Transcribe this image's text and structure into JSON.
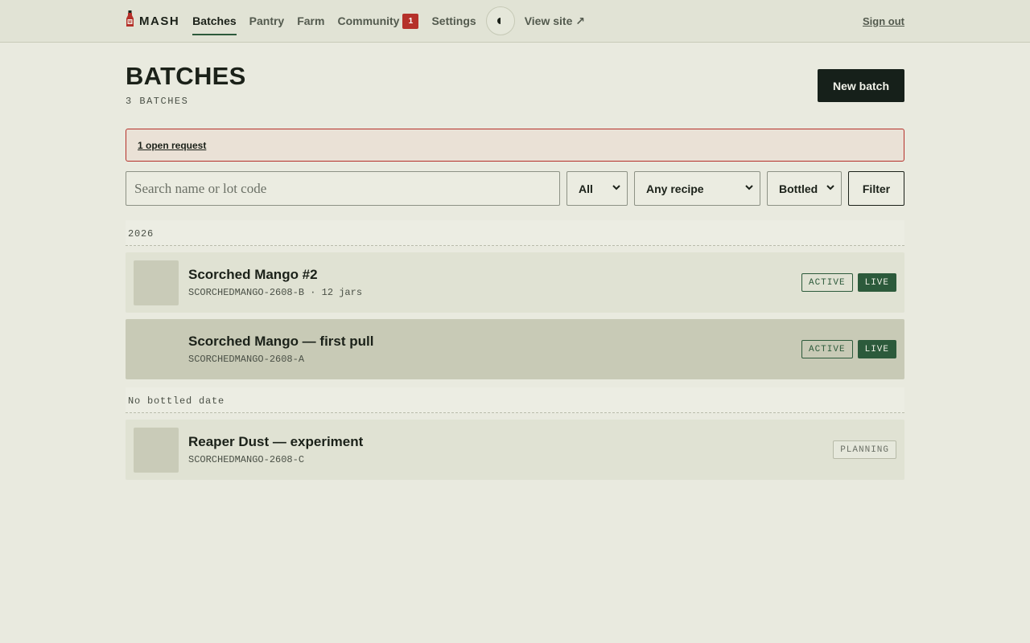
{
  "nav": {
    "brand": "MASH",
    "links": [
      {
        "label": "Batches"
      },
      {
        "label": "Pantry"
      },
      {
        "label": "Farm"
      },
      {
        "label": "Community",
        "badge": "1"
      },
      {
        "label": "Settings"
      }
    ],
    "view_site": "View site ↗",
    "sign_out": "Sign out"
  },
  "page": {
    "title": "BATCHES",
    "count": "3 BATCHES",
    "new_batch": "New batch"
  },
  "alert": {
    "text": "1 open request"
  },
  "filters": {
    "search_placeholder": "Search name or lot code",
    "status": "All",
    "recipe": "Any recipe",
    "sort": "Bottled",
    "button": "Filter"
  },
  "groups": [
    {
      "label": "2026",
      "batches": [
        {
          "name": "Scorched Mango #2",
          "sub": "SCORCHEDMANGO-2608-B · 12 jars",
          "tags": [
            "ACTIVE",
            "LIVE"
          ]
        },
        {
          "name": "Scorched Mango — first pull",
          "sub": "SCORCHEDMANGO-2608-A",
          "tags": [
            "ACTIVE",
            "LIVE"
          ]
        }
      ]
    },
    {
      "label": "No bottled date",
      "batches": [
        {
          "name": "Reaper Dust — experiment",
          "sub": "SCORCHEDMANGO-2608-C",
          "tags": [
            "PLANNING"
          ]
        }
      ]
    }
  ],
  "colors": {
    "accent_green": "#2c5a3b",
    "alert_red": "#b5312a",
    "background": "#e9eadf"
  },
  "icons": {
    "brand": "hot-sauce-bottle-icon",
    "theme": "half-moon-icon"
  }
}
